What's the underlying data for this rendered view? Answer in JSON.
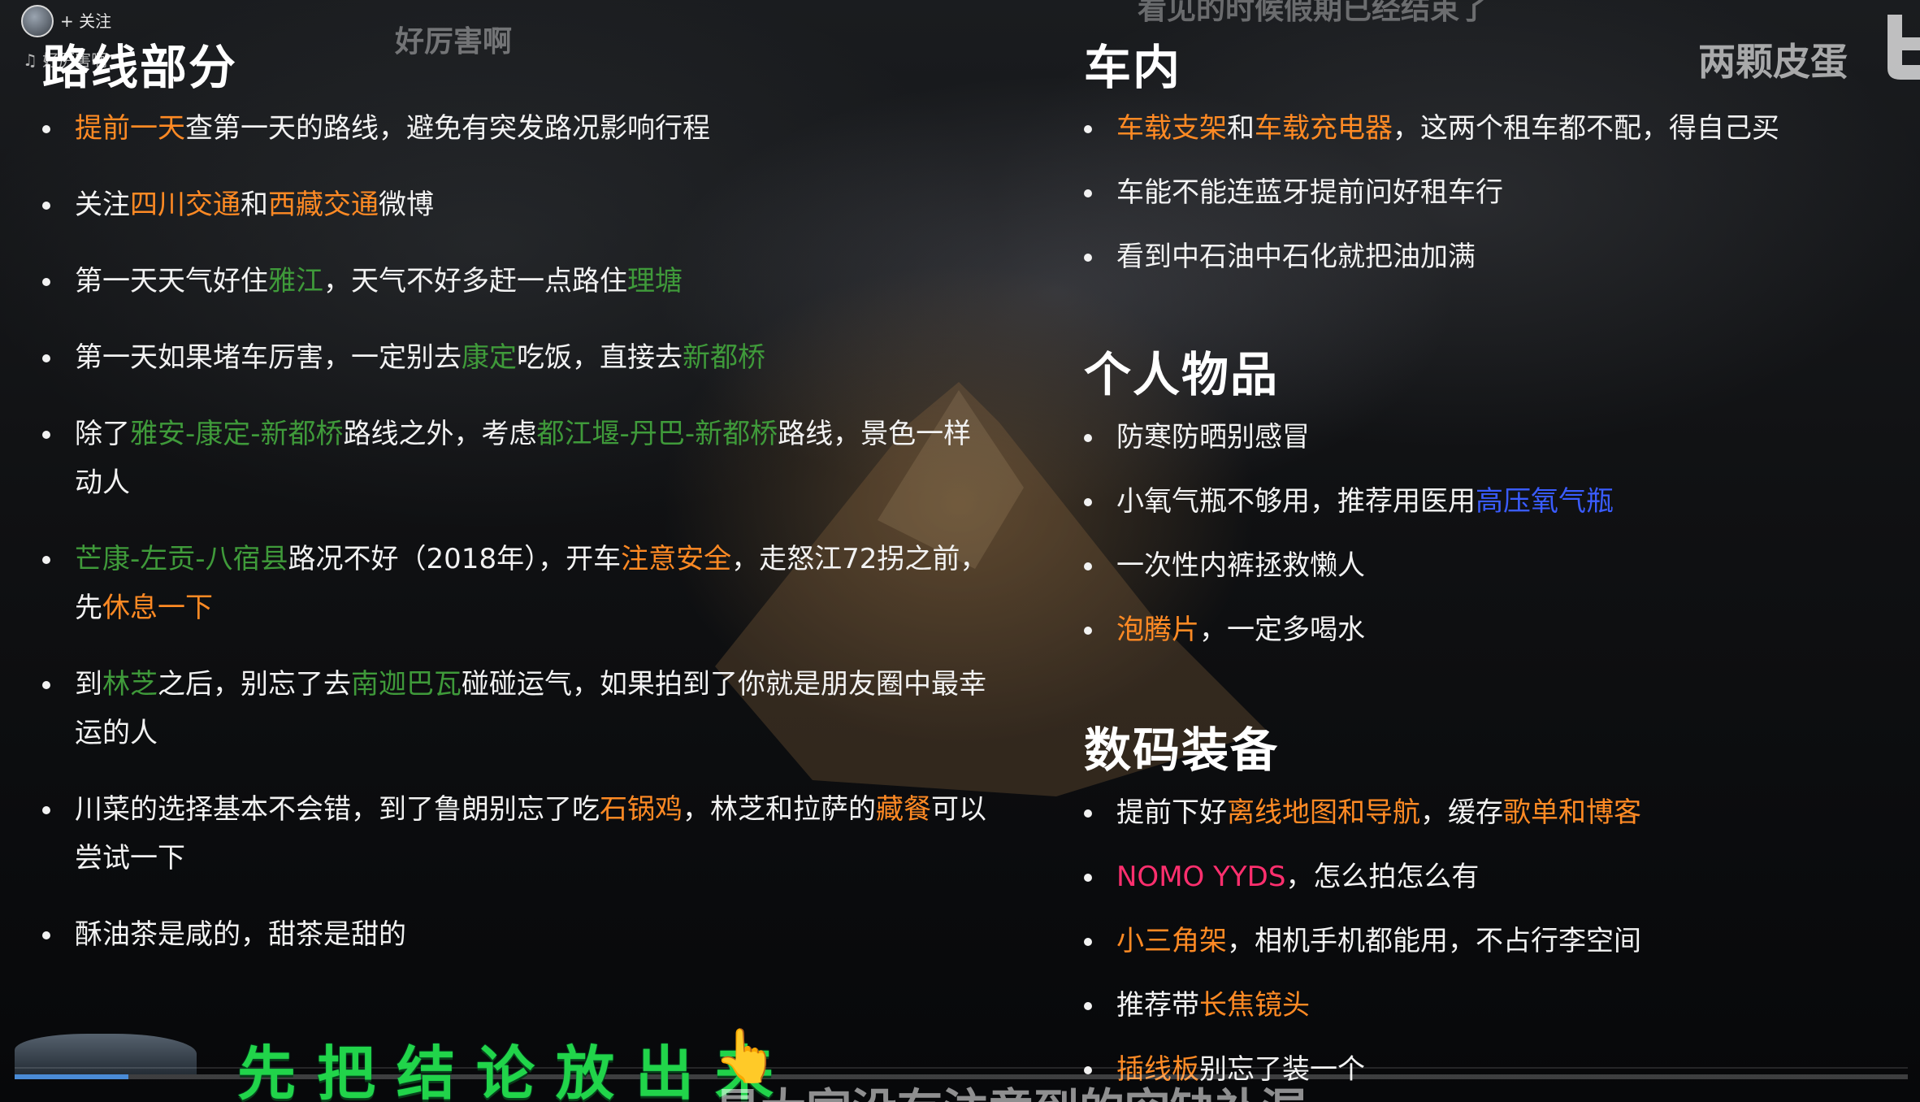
{
  "overlay": {
    "follow_label": "+ 关注",
    "music_tag": "♫ 好厉害啊",
    "watermark_left": "好厉害啊",
    "top_caption": "看见的时候假期已经结束了",
    "watermark_right": "两颗皮蛋",
    "subtitle": "先把结论放出来",
    "bottom_caption": "是大家没有注意到的空缺补漏",
    "progress_fraction": 0.06
  },
  "left": {
    "title": "路线部分",
    "items": [
      {
        "segments": [
          {
            "t": "提前一天",
            "c": "orange"
          },
          {
            "t": "查第一天的路线，避免有突发路况影响行程"
          }
        ]
      },
      {
        "segments": [
          {
            "t": "关注"
          },
          {
            "t": "四川交通",
            "c": "orange"
          },
          {
            "t": "和"
          },
          {
            "t": "西藏交通",
            "c": "orange"
          },
          {
            "t": "微博"
          }
        ]
      },
      {
        "segments": [
          {
            "t": "第一天天气好住"
          },
          {
            "t": "雅江",
            "c": "green"
          },
          {
            "t": "，天气不好多赶一点路住"
          },
          {
            "t": "理塘",
            "c": "green"
          }
        ]
      },
      {
        "segments": [
          {
            "t": "第一天如果堵车厉害，一定别去"
          },
          {
            "t": "康定",
            "c": "green"
          },
          {
            "t": "吃饭，直接去"
          },
          {
            "t": "新都桥",
            "c": "green"
          }
        ]
      },
      {
        "segments": [
          {
            "t": "除了"
          },
          {
            "t": "雅安-康定-新都桥",
            "c": "green"
          },
          {
            "t": "路线之外，考虑"
          },
          {
            "t": "都江堰-丹巴-新都桥",
            "c": "green"
          },
          {
            "t": "路线，景色一样动人"
          }
        ]
      },
      {
        "segments": [
          {
            "t": "芒康-左贡-八宿县",
            "c": "green"
          },
          {
            "t": "路况不好（2018年），开车"
          },
          {
            "t": "注意安全",
            "c": "orange"
          },
          {
            "t": "，走怒江72拐之前，先"
          },
          {
            "t": "休息一下",
            "c": "orange"
          }
        ]
      },
      {
        "segments": [
          {
            "t": "到"
          },
          {
            "t": "林芝",
            "c": "green"
          },
          {
            "t": "之后，别忘了去"
          },
          {
            "t": "南迦巴瓦",
            "c": "green"
          },
          {
            "t": "碰碰运气，如果拍到了你就是朋友圈中最幸运的人"
          }
        ]
      },
      {
        "segments": [
          {
            "t": "川菜的选择基本不会错，到了鲁朗别忘了吃"
          },
          {
            "t": "石锅鸡",
            "c": "orange"
          },
          {
            "t": "，林芝和拉萨的"
          },
          {
            "t": "藏餐",
            "c": "orange"
          },
          {
            "t": "可以尝试一下"
          }
        ]
      },
      {
        "segments": [
          {
            "t": "酥油茶是咸的，甜茶是甜的"
          }
        ]
      }
    ]
  },
  "car": {
    "title": "车内",
    "items": [
      {
        "segments": [
          {
            "t": "车载支架",
            "c": "orange"
          },
          {
            "t": "和"
          },
          {
            "t": "车载充电器",
            "c": "orange"
          },
          {
            "t": "，这两个租车都不配，得自己买"
          }
        ]
      },
      {
        "segments": [
          {
            "t": "车能不能连蓝牙提前问好租车行"
          }
        ]
      },
      {
        "segments": [
          {
            "t": "看到中石油中石化就把油加满"
          }
        ]
      }
    ]
  },
  "personal": {
    "title": "个人物品",
    "items": [
      {
        "segments": [
          {
            "t": "防寒防晒别感冒"
          }
        ]
      },
      {
        "segments": [
          {
            "t": "小氧气瓶不够用，推荐用医用"
          },
          {
            "t": "高压氧气瓶",
            "c": "blue"
          }
        ]
      },
      {
        "segments": [
          {
            "t": "一次性内裤拯救懒人"
          }
        ]
      },
      {
        "segments": [
          {
            "t": "泡腾片",
            "c": "orange"
          },
          {
            "t": "，一定多喝水"
          }
        ]
      }
    ]
  },
  "digital": {
    "title": "数码装备",
    "items": [
      {
        "segments": [
          {
            "t": "提前下好"
          },
          {
            "t": "离线地图和导航",
            "c": "orange"
          },
          {
            "t": "，缓存"
          },
          {
            "t": "歌单和博客",
            "c": "orange"
          }
        ]
      },
      {
        "segments": [
          {
            "t": "NOMO YYDS",
            "c": "pink"
          },
          {
            "t": "，怎么拍怎么有"
          }
        ]
      },
      {
        "segments": [
          {
            "t": "小三角架",
            "c": "orange"
          },
          {
            "t": "，相机手机都能用，不占行李空间"
          }
        ]
      },
      {
        "segments": [
          {
            "t": "推荐带"
          },
          {
            "t": "长焦镜头",
            "c": "orange"
          }
        ]
      },
      {
        "segments": [
          {
            "t": "插线板",
            "c": "orange"
          },
          {
            "t": "别忘了装一个"
          }
        ]
      }
    ]
  }
}
